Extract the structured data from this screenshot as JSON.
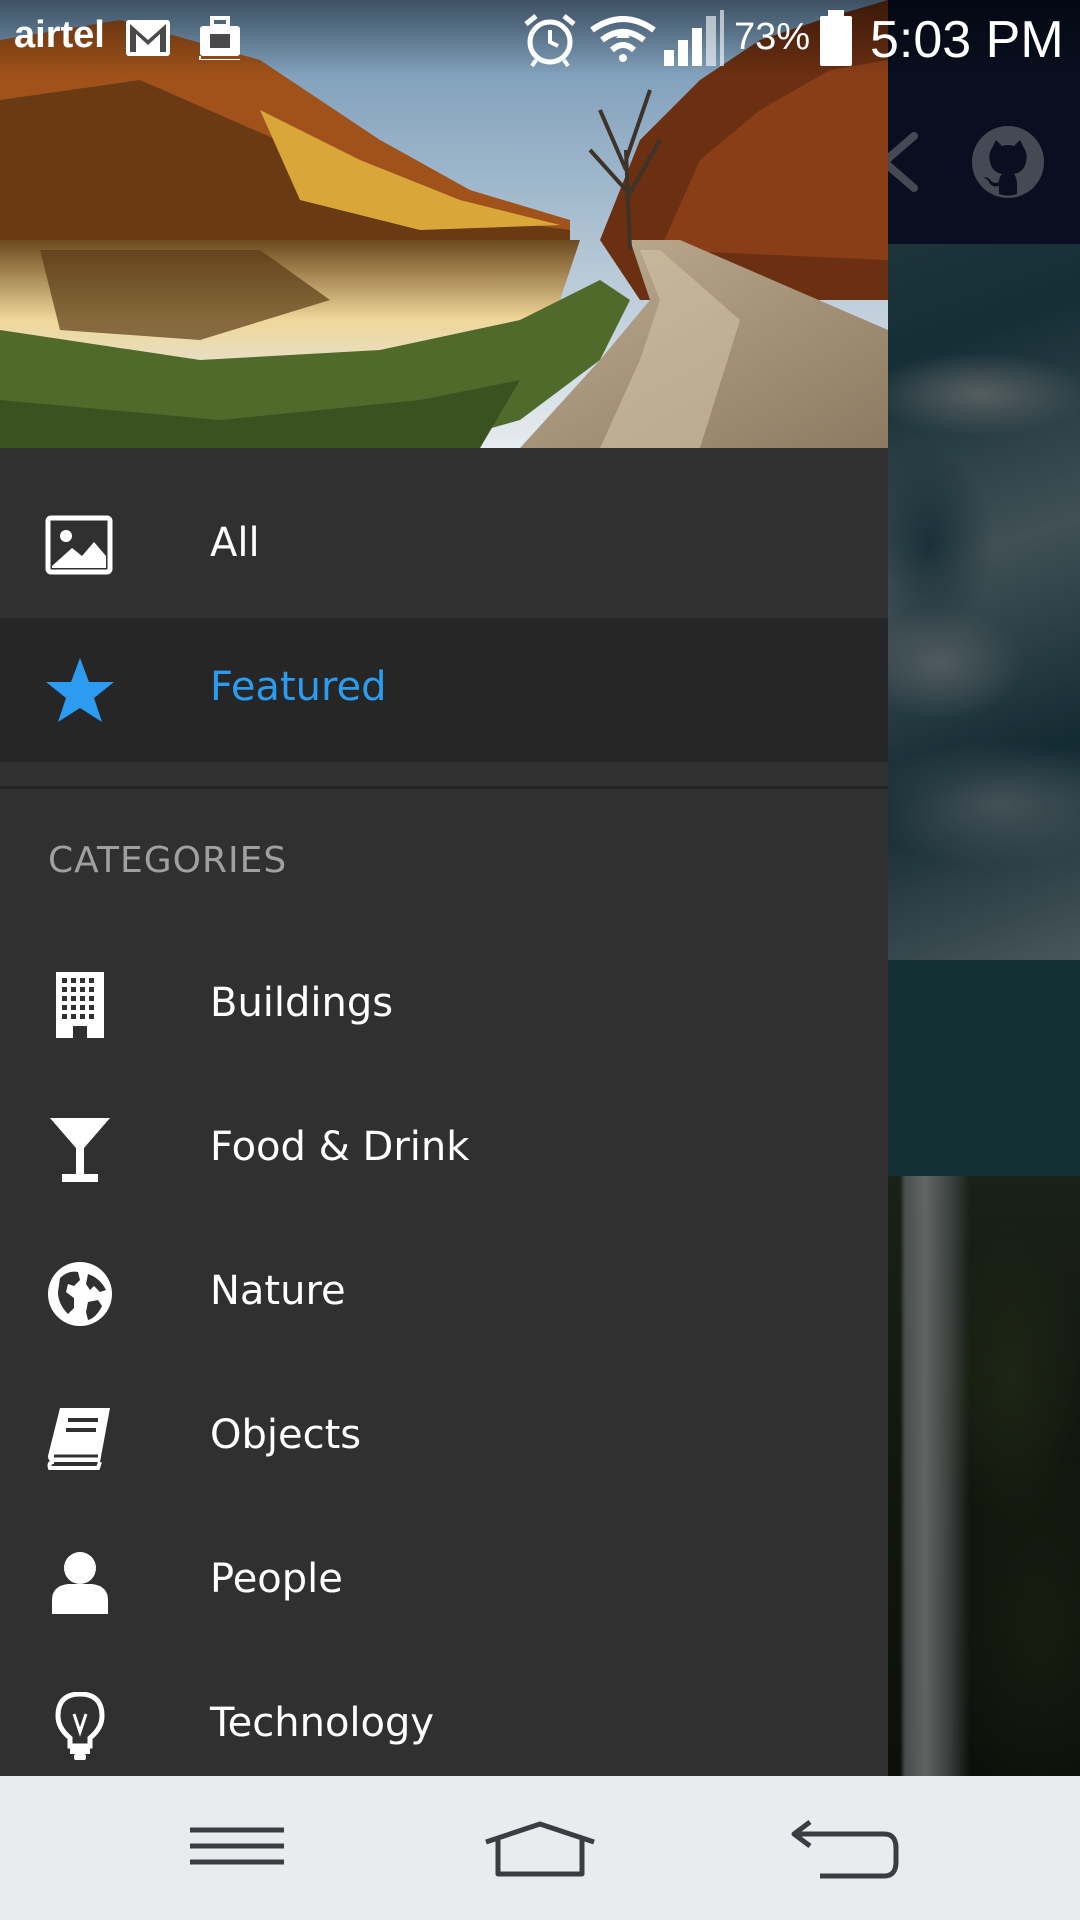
{
  "status_bar": {
    "carrier": "airtel",
    "battery": "73%",
    "time": "5:03 PM",
    "icons": [
      "gmail-icon",
      "briefcase-icon",
      "alarm-icon",
      "wifi-icon",
      "signal-icon",
      "battery-icon"
    ]
  },
  "background_app": {
    "toolbar_icons": [
      "share-icon",
      "github-icon"
    ],
    "toolbar_color": "#16224a"
  },
  "drawer": {
    "header_image": "landscape-photo",
    "items": [
      {
        "label": "All",
        "icon": "image-icon"
      },
      {
        "label": "Featured",
        "icon": "star-icon",
        "selected": true
      }
    ],
    "categories_title": "CATEGORIES",
    "categories": [
      {
        "label": "Buildings",
        "icon": "building-icon"
      },
      {
        "label": "Food & Drink",
        "icon": "cocktail-icon"
      },
      {
        "label": "Nature",
        "icon": "globe-icon"
      },
      {
        "label": "Objects",
        "icon": "book-icon"
      },
      {
        "label": "People",
        "icon": "person-icon"
      },
      {
        "label": "Technology",
        "icon": "lightbulb-icon"
      }
    ],
    "accent_color": "#2b9cf0",
    "background_color": "#303030"
  },
  "nav_bar": {
    "buttons": [
      "menu-button",
      "home-button",
      "back-button"
    ]
  }
}
